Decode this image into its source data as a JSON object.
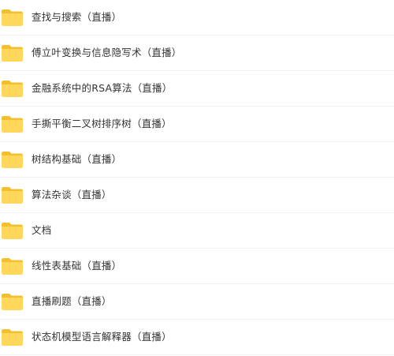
{
  "colors": {
    "folder_front": "#FFD75B",
    "folder_back": "#F3BF2F",
    "text": "#333333",
    "divider": "#F1F2F4"
  },
  "files": [
    {
      "name": "查找与搜索（直播）",
      "icon": "folder-icon"
    },
    {
      "name": "傅立叶变换与信息隐写术（直播）",
      "icon": "folder-icon"
    },
    {
      "name": "金融系统中的RSA算法（直播）",
      "icon": "folder-icon"
    },
    {
      "name": "手撕平衡二叉树排序树（直播）",
      "icon": "folder-icon"
    },
    {
      "name": "树结构基础（直播）",
      "icon": "folder-icon"
    },
    {
      "name": "算法杂谈（直播）",
      "icon": "folder-icon"
    },
    {
      "name": "文档",
      "icon": "folder-icon"
    },
    {
      "name": "线性表基础（直播）",
      "icon": "folder-icon"
    },
    {
      "name": "直播刷题（直播）",
      "icon": "folder-icon"
    },
    {
      "name": "状态机模型语言解释器（直播）",
      "icon": "folder-icon"
    }
  ]
}
